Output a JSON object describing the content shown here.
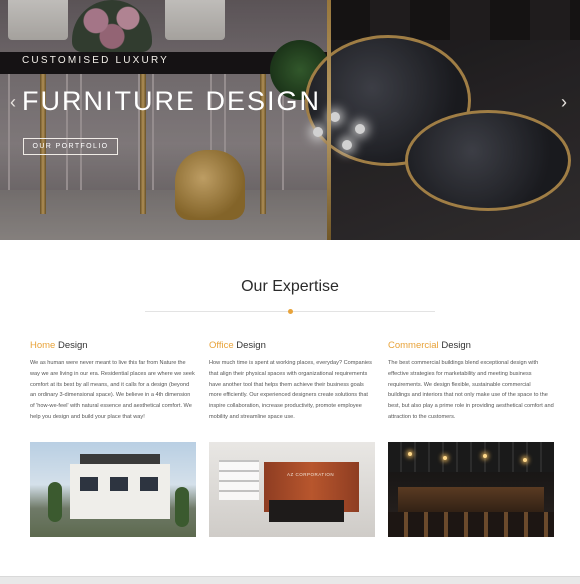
{
  "hero": {
    "subtitle": "CUSTOMISED LUXURY",
    "title": "FURNITURE DESIGN",
    "button_label": "OUR PORTFOLIO",
    "prev_arrow": "‹",
    "next_arrow": "›"
  },
  "expertise": {
    "title": "Our Expertise",
    "accent_color": "#e8a33a",
    "columns": [
      {
        "heading_accent": "Home",
        "heading_rest": " Design",
        "text": "We as human were never meant to live this far from Nature the way we are living in our era. Residential places are where we seek comfort at its best by all means, and it calls for a design (beyond an ordinary 3-dimensional space). We believe in a 4th dimension of 'how-we-feel' with natural essence and aesthetical comfort. We help you design and build your place that way!",
        "image_icon": "house-exterior-photo"
      },
      {
        "heading_accent": "Office",
        "heading_rest": " Design",
        "text": "How much time is spent at working places, everyday? Companies that align their physical spaces with organizational requirements have another tool that helps them achieve their business goals more efficiently. Our experienced designers create solutions that inspire collaboration, increase productivity, promote employee mobility and streamline space use.",
        "image_icon": "office-reception-photo",
        "image_sign": "AZ CORPORATION"
      },
      {
        "heading_accent": "Commercial",
        "heading_rest": " Design",
        "text": "The best commercial buildings blend exceptional design with effective strategies for marketability and meeting business requirements. We design flexible, sustainable commercial buildings and interiors that not only make use of the space to the best, but also play a prime role in providing aesthetical comfort and attraction to the customers.",
        "image_icon": "restaurant-interior-photo"
      }
    ]
  }
}
